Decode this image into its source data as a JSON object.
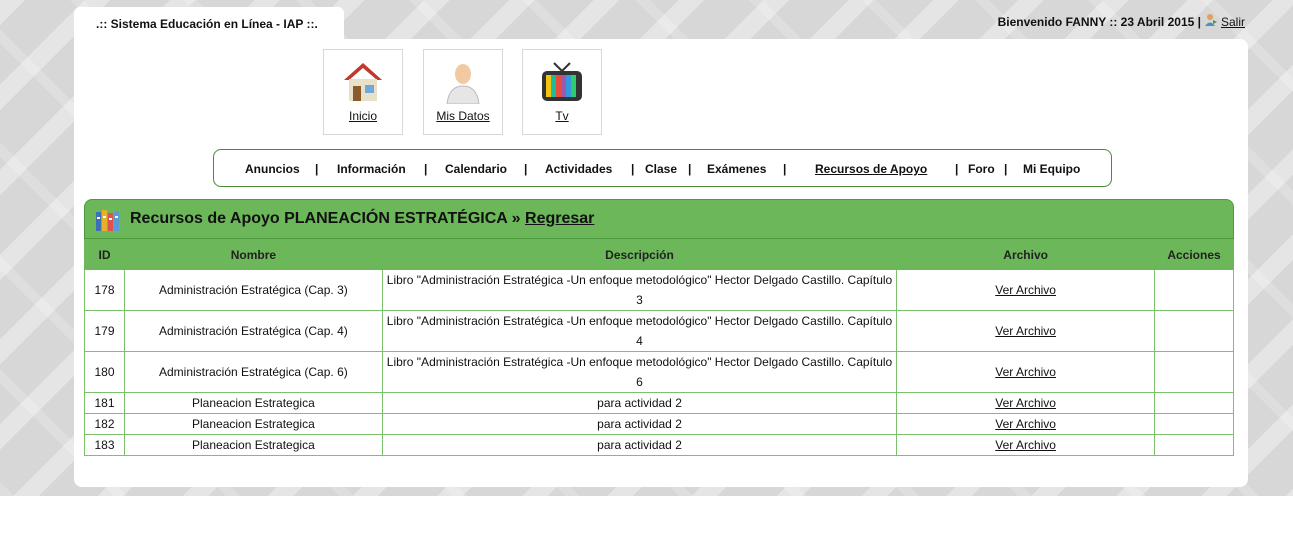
{
  "header": {
    "system_title": ".:: Sistema Educación en Línea - IAP ::.",
    "welcome_text": "Bienvenido FANNY :: 23 Abril 2015 |",
    "logout_label": "Salir"
  },
  "quick_links": [
    {
      "label": "Inicio",
      "icon": "home-icon"
    },
    {
      "label": "Mis Datos",
      "icon": "user-profile-icon"
    },
    {
      "label": "Tv",
      "icon": "tv-icon"
    }
  ],
  "nav": {
    "items": [
      "Anuncios",
      "Información",
      "Calendario",
      "Actividades",
      "Clase",
      "Exámenes",
      "Recursos de Apoyo",
      "Foro",
      "Mi Equipo"
    ],
    "separator": "|",
    "active": "Recursos de Apoyo"
  },
  "section": {
    "title": "Recursos de Apoyo PLANEACIÓN ESTRATÉGICA »",
    "back_label": "Regresar",
    "icon": "books-icon"
  },
  "table": {
    "columns": [
      "ID",
      "Nombre",
      "Descripción",
      "Archivo",
      "Acciones"
    ],
    "rows": [
      {
        "id": "178",
        "nombre": "Administración Estratégica (Cap. 3)",
        "descripcion": "Libro \"Administración Estratégica -Un enfoque metodológico\" Hector Delgado Castillo. Capítulo 3",
        "archivo": "Ver Archivo",
        "acciones": ""
      },
      {
        "id": "179",
        "nombre": "Administración Estratégica (Cap. 4)",
        "descripcion": "Libro \"Administración Estratégica -Un enfoque metodológico\" Hector Delgado Castillo. Capítulo 4",
        "archivo": "Ver Archivo",
        "acciones": ""
      },
      {
        "id": "180",
        "nombre": "Administración Estratégica (Cap. 6)",
        "descripcion": "Libro \"Administración Estratégica -Un enfoque metodológico\" Hector Delgado Castillo. Capítulo 6",
        "archivo": "Ver Archivo",
        "acciones": ""
      },
      {
        "id": "181",
        "nombre": "Planeacion Estrategica",
        "descripcion": "para actividad 2",
        "archivo": "Ver Archivo",
        "acciones": ""
      },
      {
        "id": "182",
        "nombre": "Planeacion Estrategica",
        "descripcion": "para actividad 2",
        "archivo": "Ver Archivo",
        "acciones": ""
      },
      {
        "id": "183",
        "nombre": "Planeacion Estrategica",
        "descripcion": "para actividad 2",
        "archivo": "Ver Archivo",
        "acciones": ""
      }
    ]
  },
  "colors": {
    "accent_green": "#6cb75a",
    "border_green": "#7cc16b"
  }
}
